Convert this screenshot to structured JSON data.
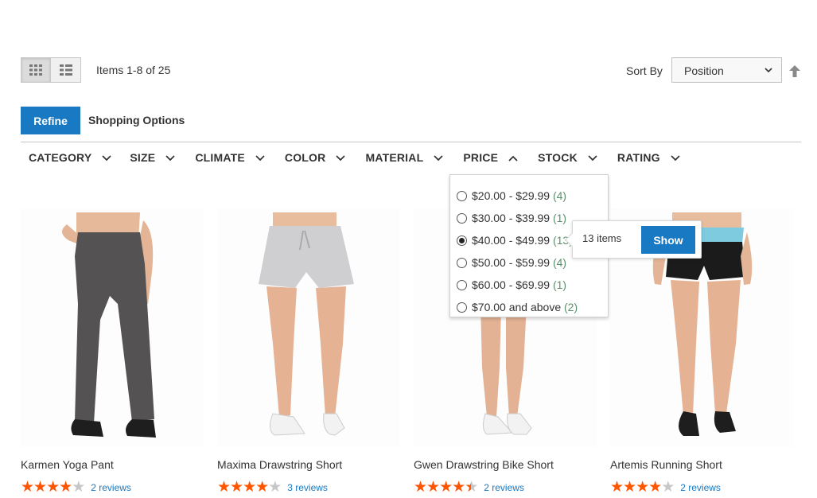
{
  "toolbar": {
    "view_grid": "grid",
    "view_list": "list",
    "items_count": "Items 1-8 of 25",
    "sort_label": "Sort By",
    "sort_value": "Position"
  },
  "refine": {
    "button_label": "Refine",
    "title": "Shopping Options"
  },
  "filters": [
    "CATEGORY",
    "SIZE",
    "CLIMATE",
    "COLOR",
    "MATERIAL",
    "PRICE",
    "STOCK",
    "RATING"
  ],
  "price_filter": {
    "options": [
      {
        "label": "$20.00 - $29.99",
        "count": "(4)",
        "selected": false
      },
      {
        "label": "$30.00 - $39.99",
        "count": "(1)",
        "selected": false
      },
      {
        "label": "$40.00 - $49.99",
        "count": "(13)",
        "selected": true
      },
      {
        "label": "$50.00 - $59.99",
        "count": "(4)",
        "selected": false
      },
      {
        "label": "$60.00 - $69.99",
        "count": "(1)",
        "selected": false
      },
      {
        "label": "$70.00 and above",
        "count": "(2)",
        "selected": false
      }
    ]
  },
  "popup": {
    "items_text": "13 items",
    "show_label": "Show"
  },
  "products": [
    {
      "name": "Karmen Yoga Pant",
      "rating": 4,
      "reviews": "2 reviews"
    },
    {
      "name": "Maxima Drawstring Short",
      "rating": 4,
      "reviews": "3 reviews"
    },
    {
      "name": "Gwen Drawstring Bike Short",
      "rating": 4.5,
      "reviews": "2 reviews"
    },
    {
      "name": "Artemis Running Short",
      "rating": 4,
      "reviews": "2 reviews"
    }
  ],
  "colors": {
    "accent": "#1979c3",
    "star": "#ff5501",
    "star_empty": "#c7c7c7"
  }
}
